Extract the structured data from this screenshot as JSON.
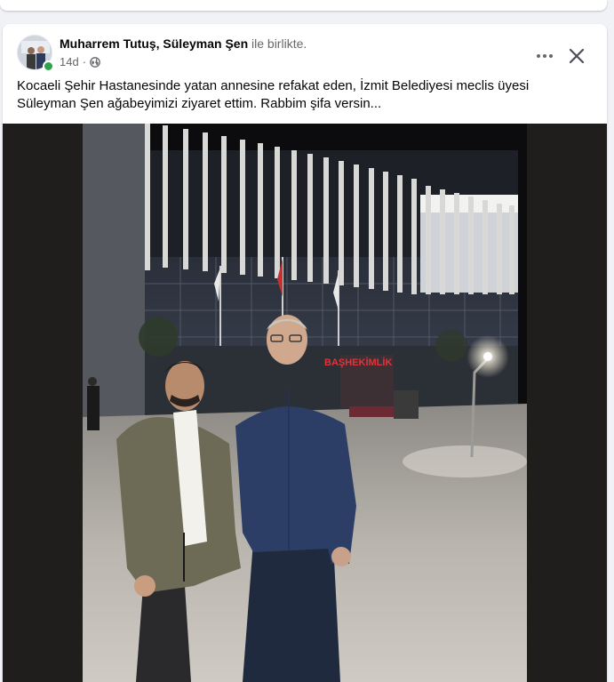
{
  "post": {
    "authors_primary": "Muharrem Tutuş, Süleyman Şen",
    "with_suffix": " ile birlikte.",
    "time": "14d",
    "separator": "·",
    "privacy_icon": "globe-icon",
    "text": "Kocaeli Şehir Hastanesinde yatan annesine refakat eden, İzmit Belediyesi meclis üyesi Süleyman Şen ağabeyimizi ziyaret ettim. Rabbim şifa versin..."
  },
  "photo": {
    "sign_text": "BAŞHEKİMLİK"
  },
  "actions": {
    "more_icon": "more-options-icon",
    "close_icon": "close-icon"
  },
  "colors": {
    "online": "#31a24c",
    "sign_red": "#e0343a",
    "text_primary": "#050505",
    "text_secondary": "#65676b"
  }
}
